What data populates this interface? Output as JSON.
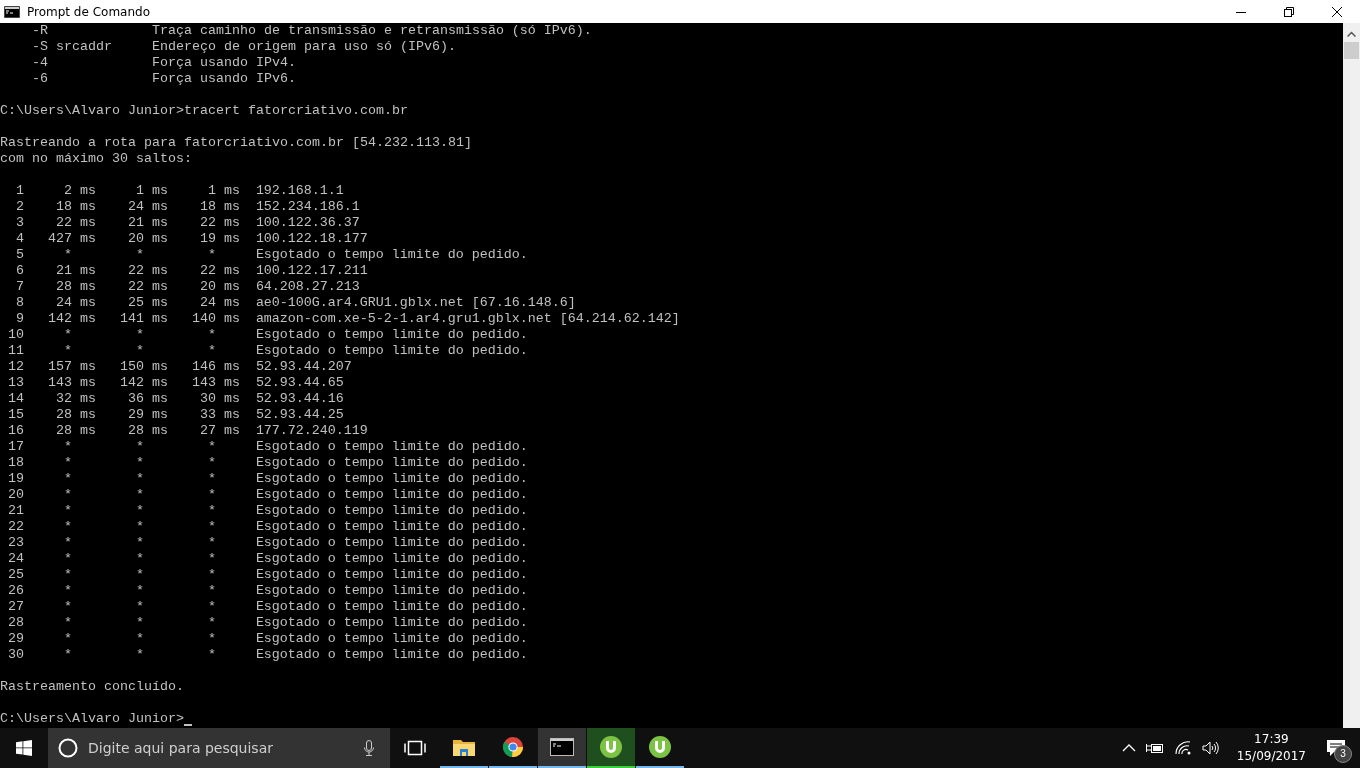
{
  "window": {
    "title": "Prompt de Comando"
  },
  "console": {
    "help_lines": [
      {
        "option": "-R",
        "description": "Traça caminho de transmissão e retransmissão (só IPv6)."
      },
      {
        "option": "-S srcaddr",
        "description": "Endereço de origem para uso só (IPv6)."
      },
      {
        "option": "-4",
        "description": "Força usando IPv4."
      },
      {
        "option": "-6",
        "description": "Força usando IPv6."
      }
    ],
    "command_prompt": "C:\\Users\\Alvaro Junior>",
    "command": "tracert fatorcriativo.com.br",
    "header_lines": [
      "Rastreando a rota para fatorcriativo.com.br [54.232.113.81]",
      "com no máximo 30 saltos:"
    ],
    "hops": [
      {
        "kind": "reply",
        "hop": "1",
        "rtt": [
          "2 ms",
          "1 ms",
          "1 ms"
        ],
        "address": "192.168.1.1"
      },
      {
        "kind": "reply",
        "hop": "2",
        "rtt": [
          "18 ms",
          "24 ms",
          "18 ms"
        ],
        "address": "152.234.186.1"
      },
      {
        "kind": "reply",
        "hop": "3",
        "rtt": [
          "22 ms",
          "21 ms",
          "22 ms"
        ],
        "address": "100.122.36.37"
      },
      {
        "kind": "reply",
        "hop": "4",
        "rtt": [
          "427 ms",
          "20 ms",
          "19 ms"
        ],
        "address": "100.122.18.177"
      },
      {
        "kind": "timeout",
        "hop": "5",
        "rtt": [
          "*",
          "*",
          "*"
        ],
        "address": "Esgotado o tempo limite do pedido."
      },
      {
        "kind": "reply",
        "hop": "6",
        "rtt": [
          "21 ms",
          "22 ms",
          "22 ms"
        ],
        "address": "100.122.17.211"
      },
      {
        "kind": "reply",
        "hop": "7",
        "rtt": [
          "28 ms",
          "22 ms",
          "20 ms"
        ],
        "address": "64.208.27.213"
      },
      {
        "kind": "reply",
        "hop": "8",
        "rtt": [
          "24 ms",
          "25 ms",
          "24 ms"
        ],
        "address": "ae0-100G.ar4.GRU1.gblx.net [67.16.148.6]"
      },
      {
        "kind": "reply",
        "hop": "9",
        "rtt": [
          "142 ms",
          "141 ms",
          "140 ms"
        ],
        "address": "amazon-com.xe-5-2-1.ar4.gru1.gblx.net [64.214.62.142]"
      },
      {
        "kind": "timeout",
        "hop": "10",
        "rtt": [
          "*",
          "*",
          "*"
        ],
        "address": "Esgotado o tempo limite do pedido."
      },
      {
        "kind": "timeout",
        "hop": "11",
        "rtt": [
          "*",
          "*",
          "*"
        ],
        "address": "Esgotado o tempo limite do pedido."
      },
      {
        "kind": "reply",
        "hop": "12",
        "rtt": [
          "157 ms",
          "150 ms",
          "146 ms"
        ],
        "address": "52.93.44.207"
      },
      {
        "kind": "reply",
        "hop": "13",
        "rtt": [
          "143 ms",
          "142 ms",
          "143 ms"
        ],
        "address": "52.93.44.65"
      },
      {
        "kind": "reply",
        "hop": "14",
        "rtt": [
          "32 ms",
          "36 ms",
          "30 ms"
        ],
        "address": "52.93.44.16"
      },
      {
        "kind": "reply",
        "hop": "15",
        "rtt": [
          "28 ms",
          "29 ms",
          "33 ms"
        ],
        "address": "52.93.44.25"
      },
      {
        "kind": "reply",
        "hop": "16",
        "rtt": [
          "28 ms",
          "28 ms",
          "27 ms"
        ],
        "address": "177.72.240.119"
      },
      {
        "kind": "timeout",
        "hop": "17",
        "rtt": [
          "*",
          "*",
          "*"
        ],
        "address": "Esgotado o tempo limite do pedido."
      },
      {
        "kind": "timeout",
        "hop": "18",
        "rtt": [
          "*",
          "*",
          "*"
        ],
        "address": "Esgotado o tempo limite do pedido."
      },
      {
        "kind": "timeout",
        "hop": "19",
        "rtt": [
          "*",
          "*",
          "*"
        ],
        "address": "Esgotado o tempo limite do pedido."
      },
      {
        "kind": "timeout",
        "hop": "20",
        "rtt": [
          "*",
          "*",
          "*"
        ],
        "address": "Esgotado o tempo limite do pedido."
      },
      {
        "kind": "timeout",
        "hop": "21",
        "rtt": [
          "*",
          "*",
          "*"
        ],
        "address": "Esgotado o tempo limite do pedido."
      },
      {
        "kind": "timeout",
        "hop": "22",
        "rtt": [
          "*",
          "*",
          "*"
        ],
        "address": "Esgotado o tempo limite do pedido."
      },
      {
        "kind": "timeout",
        "hop": "23",
        "rtt": [
          "*",
          "*",
          "*"
        ],
        "address": "Esgotado o tempo limite do pedido."
      },
      {
        "kind": "timeout",
        "hop": "24",
        "rtt": [
          "*",
          "*",
          "*"
        ],
        "address": "Esgotado o tempo limite do pedido."
      },
      {
        "kind": "timeout",
        "hop": "25",
        "rtt": [
          "*",
          "*",
          "*"
        ],
        "address": "Esgotado o tempo limite do pedido."
      },
      {
        "kind": "timeout",
        "hop": "26",
        "rtt": [
          "*",
          "*",
          "*"
        ],
        "address": "Esgotado o tempo limite do pedido."
      },
      {
        "kind": "timeout",
        "hop": "27",
        "rtt": [
          "*",
          "*",
          "*"
        ],
        "address": "Esgotado o tempo limite do pedido."
      },
      {
        "kind": "timeout",
        "hop": "28",
        "rtt": [
          "*",
          "*",
          "*"
        ],
        "address": "Esgotado o tempo limite do pedido."
      },
      {
        "kind": "timeout",
        "hop": "29",
        "rtt": [
          "*",
          "*",
          "*"
        ],
        "address": "Esgotado o tempo limite do pedido."
      },
      {
        "kind": "timeout",
        "hop": "30",
        "rtt": [
          "*",
          "*",
          "*"
        ],
        "address": "Esgotado o tempo limite do pedido."
      }
    ],
    "done_message": "Rastreamento concluído.",
    "final_prompt": "C:\\Users\\Alvaro Junior>"
  },
  "taskbar": {
    "search": {
      "placeholder": "Digite aqui para pesquisar"
    },
    "apps": [
      {
        "kind": "folder",
        "selected": false,
        "attention": false
      },
      {
        "kind": "chrome",
        "selected": false,
        "attention": false
      },
      {
        "kind": "console",
        "selected": true,
        "attention": false
      },
      {
        "kind": "torrent",
        "selected": false,
        "attention": true
      },
      {
        "kind": "torrent",
        "selected": false,
        "attention": false
      }
    ],
    "clock": {
      "time": "17:39",
      "date": "15/09/2017"
    },
    "notifications": {
      "count": "3"
    }
  }
}
